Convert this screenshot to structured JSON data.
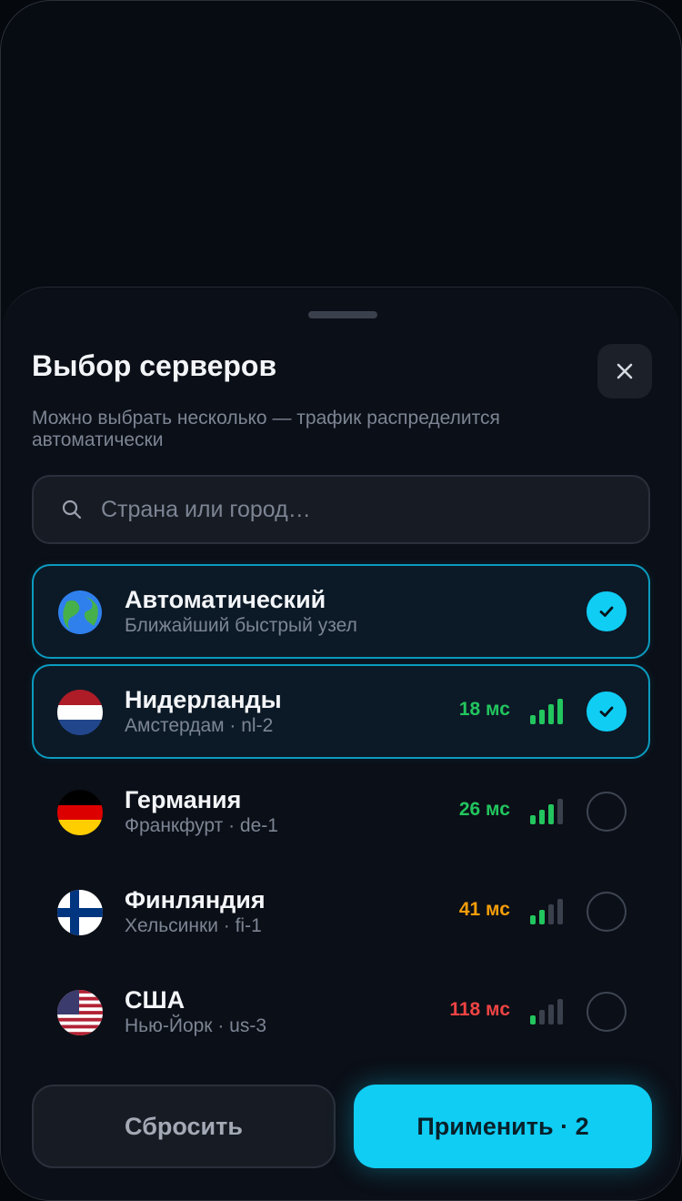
{
  "sheet": {
    "title": "Выбор серверов",
    "subtitle": "Можно выбрать несколько — трафик распределится автоматически",
    "search": {
      "placeholder": "Страна или город…",
      "value": ""
    },
    "icons": {
      "close": "close-icon",
      "search": "search-icon"
    }
  },
  "servers": [
    {
      "flag": "🌍",
      "icon": "globe-icon",
      "name": "Автоматический",
      "sub": "Ближайший быстрый узел",
      "ping": "",
      "signal": null,
      "selected": true
    },
    {
      "flag": "nl",
      "icon": "flag-netherlands-icon",
      "name": "Нидерланды",
      "sub": "Амстердам · nl-2",
      "ping": "18 мс",
      "ping_color": "#22c55e",
      "signal": 4,
      "selected": true
    },
    {
      "flag": "de",
      "icon": "flag-germany-icon",
      "name": "Германия",
      "sub": "Франкфурт · de-1",
      "ping": "26 мс",
      "ping_color": "#22c55e",
      "signal": 3,
      "selected": false
    },
    {
      "flag": "fi",
      "icon": "flag-finland-icon",
      "name": "Финляндия",
      "sub": "Хельсинки · fi-1",
      "ping": "41 мс",
      "ping_color": "#f59e0b",
      "signal": 2,
      "selected": false
    },
    {
      "flag": "us",
      "icon": "flag-usa-icon",
      "name": "США",
      "sub": "Нью-Йорк · us-3",
      "ping": "118 мс",
      "ping_color": "#ef4444",
      "signal": 1,
      "selected": false
    }
  ],
  "actions": {
    "reset_label": "Сбросить",
    "apply_label": "Применить · 2"
  },
  "colors": {
    "accent": "#10cdf4",
    "signal_on": "#22c55e",
    "signal_off": "#3a404c"
  }
}
